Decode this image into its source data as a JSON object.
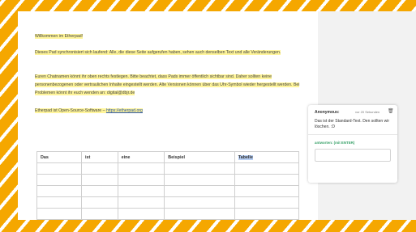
{
  "pad": {
    "p1": "Willkommen im Etherpad!",
    "p2": "Dieses Pad synchronisiert sich laufend: Alle, die diese Seite aufgerufen haben, sehen auch denselben Text und alle Veränderungen.",
    "p3": "Euren Chatnamen könnt ihr oben rechts festlegen. Bitte beachtet, dass Pads immer öffentlich sichtbar sind. Daher sollten keine personenbezogenen oder vertraulichen Inhalte eingestellt werden. Alte Versionen können über das Uhr-Symbol wieder hergestellt werden. Bei Problemen könnt ihr euch wenden an: digital@dbjr.de",
    "p4_text": "Etherpad ist Open-Source-Software – ",
    "p4_link": "https://etherpad.org"
  },
  "table": {
    "headers": [
      "Das",
      "ist",
      "eine",
      "Beispiel",
      "Tabelle"
    ]
  },
  "comment": {
    "author": "Anonymous:",
    "time": "vor 20 Sekunden",
    "text": "Das ist der Standard-Text. Den sollten wir löschen. :D",
    "reply_label": "antworten: (mit ENTER)"
  }
}
